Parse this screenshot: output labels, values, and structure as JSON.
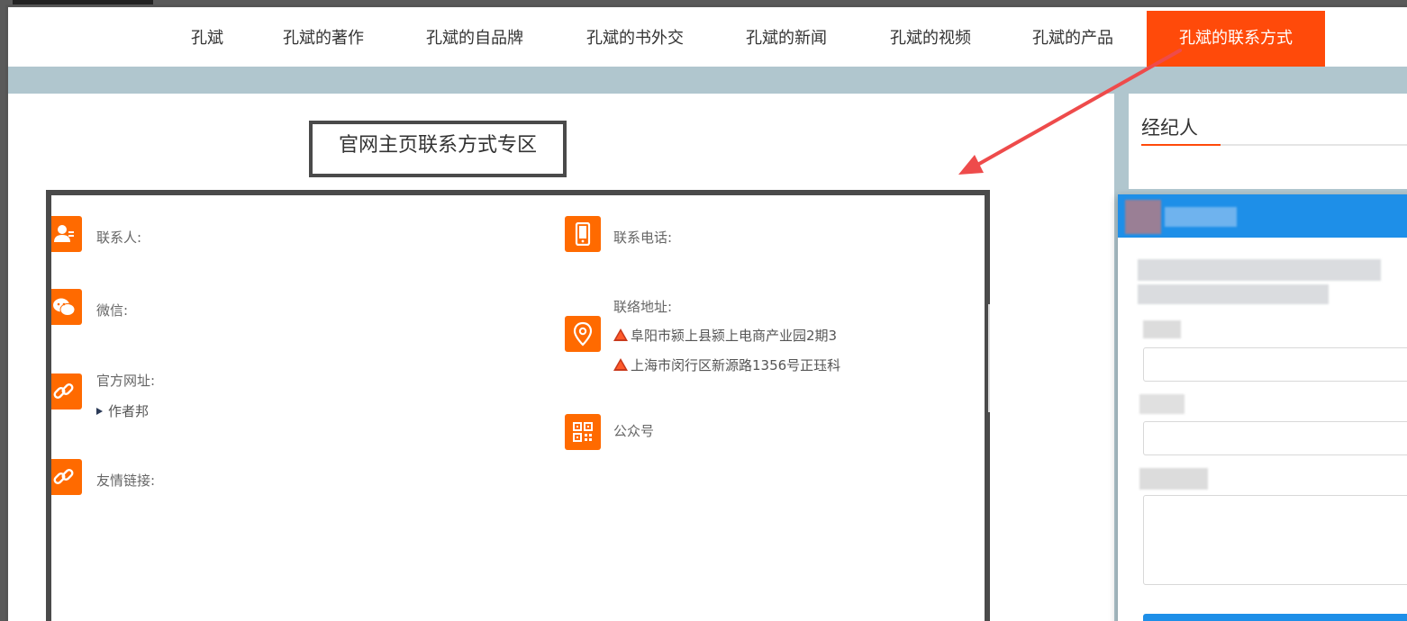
{
  "nav": {
    "items": [
      {
        "label": "孔斌"
      },
      {
        "label": "孔斌的著作"
      },
      {
        "label": "孔斌的自品牌"
      },
      {
        "label": "孔斌的书外交"
      },
      {
        "label": "孔斌的新闻"
      },
      {
        "label": "孔斌的视频"
      },
      {
        "label": "孔斌的产品"
      },
      {
        "label": "孔斌的联系方式"
      }
    ],
    "active_index": 7
  },
  "main": {
    "title": "官网主页联系方式专区",
    "contacts": {
      "person_label": "联系人:",
      "wechat_label": "微信:",
      "website_label": "官方网址:",
      "website_link": "作者邦",
      "friend_links_label": "友情链接:",
      "phone_label": "联系电话:",
      "address_label": "联络地址:",
      "address_1": "阜阳市颍上县颍上电商产业园2期3",
      "address_2": "上海市闵行区新源路1356号正珏科",
      "wechat_official_label": "公众号"
    }
  },
  "sidebar": {
    "agent_title": "经纪人"
  },
  "colors": {
    "accent": "#ff4a0a",
    "icon_bg": "#ff6a00",
    "band": "#b0c6ce",
    "popup_head": "#1e8fe8"
  }
}
